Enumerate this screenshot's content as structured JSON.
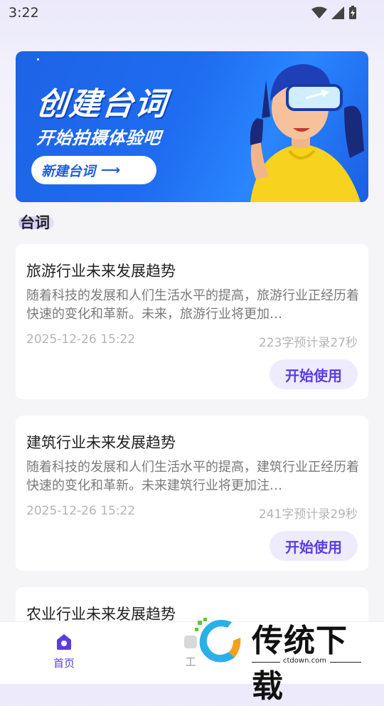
{
  "status_bar": {
    "time": "3:22"
  },
  "banner": {
    "title": "创建台词",
    "subtitle": "开始拍摄体验吧",
    "cta_label": "新建台词",
    "cta_arrow": "⟶"
  },
  "section": {
    "title": "台词"
  },
  "cards": [
    {
      "title": "旅游行业未来发展趋势",
      "body": "随着科技的发展和人们生活水平的提高，旅游行业正经历着快速的变化和革新。未来，旅游行业将更加…",
      "date": "2025-12-26 15:22",
      "meta": "223字预计录27秒",
      "button": "开始使用"
    },
    {
      "title": "建筑行业未来发展趋势",
      "body": "随着科技的发展和人们生活水平的提高，建筑行业正经历着快速的变化和革新。未来建筑行业将更加注…",
      "date": "2025-12-26 15:22",
      "meta": "241字预计录29秒",
      "button": "开始使用"
    },
    {
      "title": "农业行业未来发展趋势"
    }
  ],
  "bottom_nav": {
    "home_label": "首页",
    "other_label": "工"
  },
  "watermark": {
    "brand": "传统下载",
    "domain": "ctdown.com"
  },
  "colors": {
    "accent": "#5b3de0",
    "banner_blue": "#1f6cf0",
    "button_bg": "#eeebfd"
  }
}
